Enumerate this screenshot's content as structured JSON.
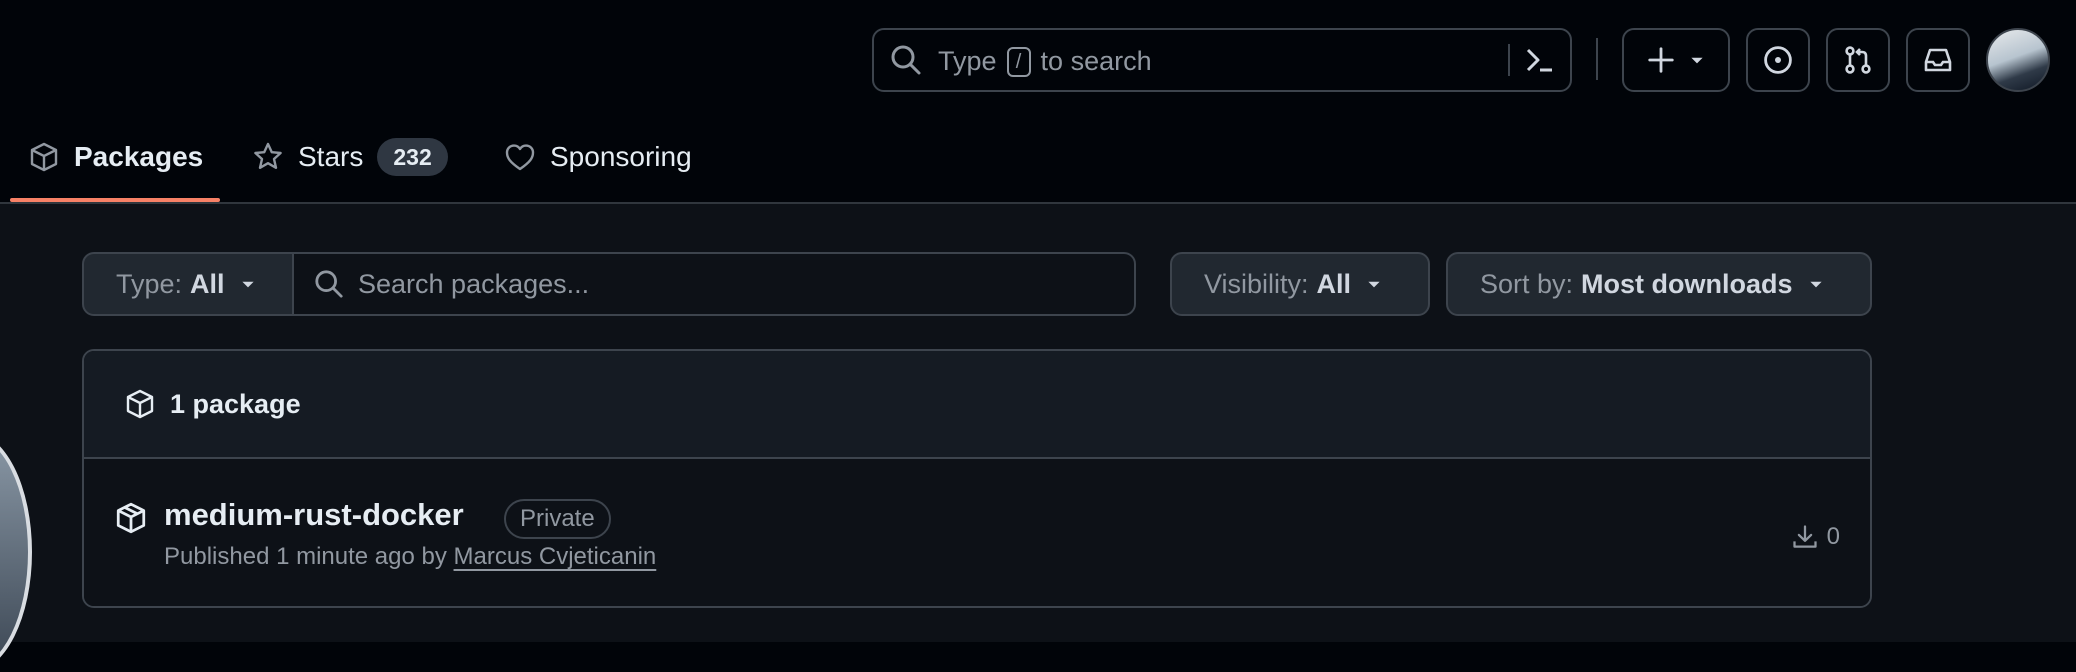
{
  "header": {
    "search": {
      "prefix": "Type",
      "key": "/",
      "suffix": "to search"
    },
    "icons": [
      "search-icon",
      "command-palette-icon",
      "plus-icon",
      "triangle-down-icon",
      "issue-opened-icon",
      "git-pull-request-icon",
      "inbox-icon"
    ]
  },
  "tabs": [
    {
      "label": "Packages",
      "icon": "package-icon",
      "active": true
    },
    {
      "label": "Stars",
      "icon": "star-icon",
      "count": "232"
    },
    {
      "label": "Sponsoring",
      "icon": "heart-icon"
    }
  ],
  "filters": {
    "type": {
      "label": "Type:",
      "value": "All"
    },
    "search_placeholder": "Search packages...",
    "visibility": {
      "label": "Visibility:",
      "value": "All"
    },
    "sort": {
      "label": "Sort by:",
      "value": "Most downloads"
    }
  },
  "packages": {
    "count_label": "1 package",
    "items": [
      {
        "name": "medium-rust-docker",
        "visibility": "Private",
        "published": "Published 1 minute ago by",
        "author": "Marcus Cvjeticanin",
        "downloads": "0"
      }
    ]
  },
  "colors": {
    "accent_underline": "#f78166",
    "header_bg": "#010409",
    "page_bg": "#0d1117",
    "border": "#3d444d",
    "text_muted": "#9198a1"
  }
}
